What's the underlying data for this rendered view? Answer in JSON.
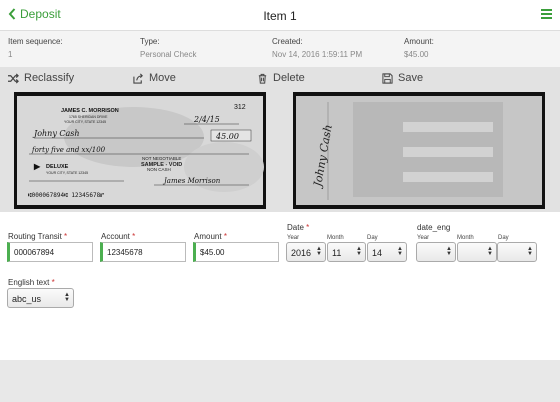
{
  "header": {
    "back_label": "Deposit",
    "title": "Item 1"
  },
  "meta": {
    "sequence_label": "Item sequence:",
    "sequence_value": "1",
    "type_label": "Type:",
    "type_value": "Personal Check",
    "created_label": "Created:",
    "created_value": "Nov 14, 2016 1:59:11 PM",
    "amount_label": "Amount:",
    "amount_value": "$45.00"
  },
  "actions": {
    "reclassify": "Reclassify",
    "move": "Move",
    "delete": "Delete",
    "save": "Save"
  },
  "check_front": {
    "number": "312",
    "name": "JAMES C. MORRISON",
    "address1": "1765 SHERIDAN DRIVE",
    "address2": "YOUR CITY, STATE 12345",
    "date": "2/4/15",
    "payee": "Johny Cash",
    "amount": "45.00",
    "words": "forty five and xx/100",
    "void1": "NOT NEGOTIABLE",
    "void2": "SAMPLE - VOID",
    "void3": "NON CASH",
    "bank": "DELUXE",
    "bank_addr": "YOUR CITY, STATE 12345",
    "micr": "⑆000067894⑆  12345678⑈",
    "signature": "James Morrison"
  },
  "check_back": {
    "endorsement": "Johny Cash"
  },
  "form": {
    "routing_label": "Routing Transit",
    "routing_value": "000067894",
    "account_label": "Account",
    "account_value": "12345678",
    "amount_label": "Amount",
    "amount_value": "$45.00",
    "date_label": "Date",
    "year_label": "Year",
    "month_label": "Month",
    "day_label": "Day",
    "year_value": "2016",
    "month_value": "11",
    "day_value": "14",
    "date_eng_label": "date_eng",
    "eng_year_label": "Year",
    "eng_month_label": "Month",
    "eng_day_label": "Day",
    "english_text_label": "English text",
    "english_text_value": "abc_us",
    "required_mark": "*"
  },
  "colors": {
    "accent": "#3a9e3a",
    "required": "#cc3333",
    "valid_border": "#4caf50"
  }
}
